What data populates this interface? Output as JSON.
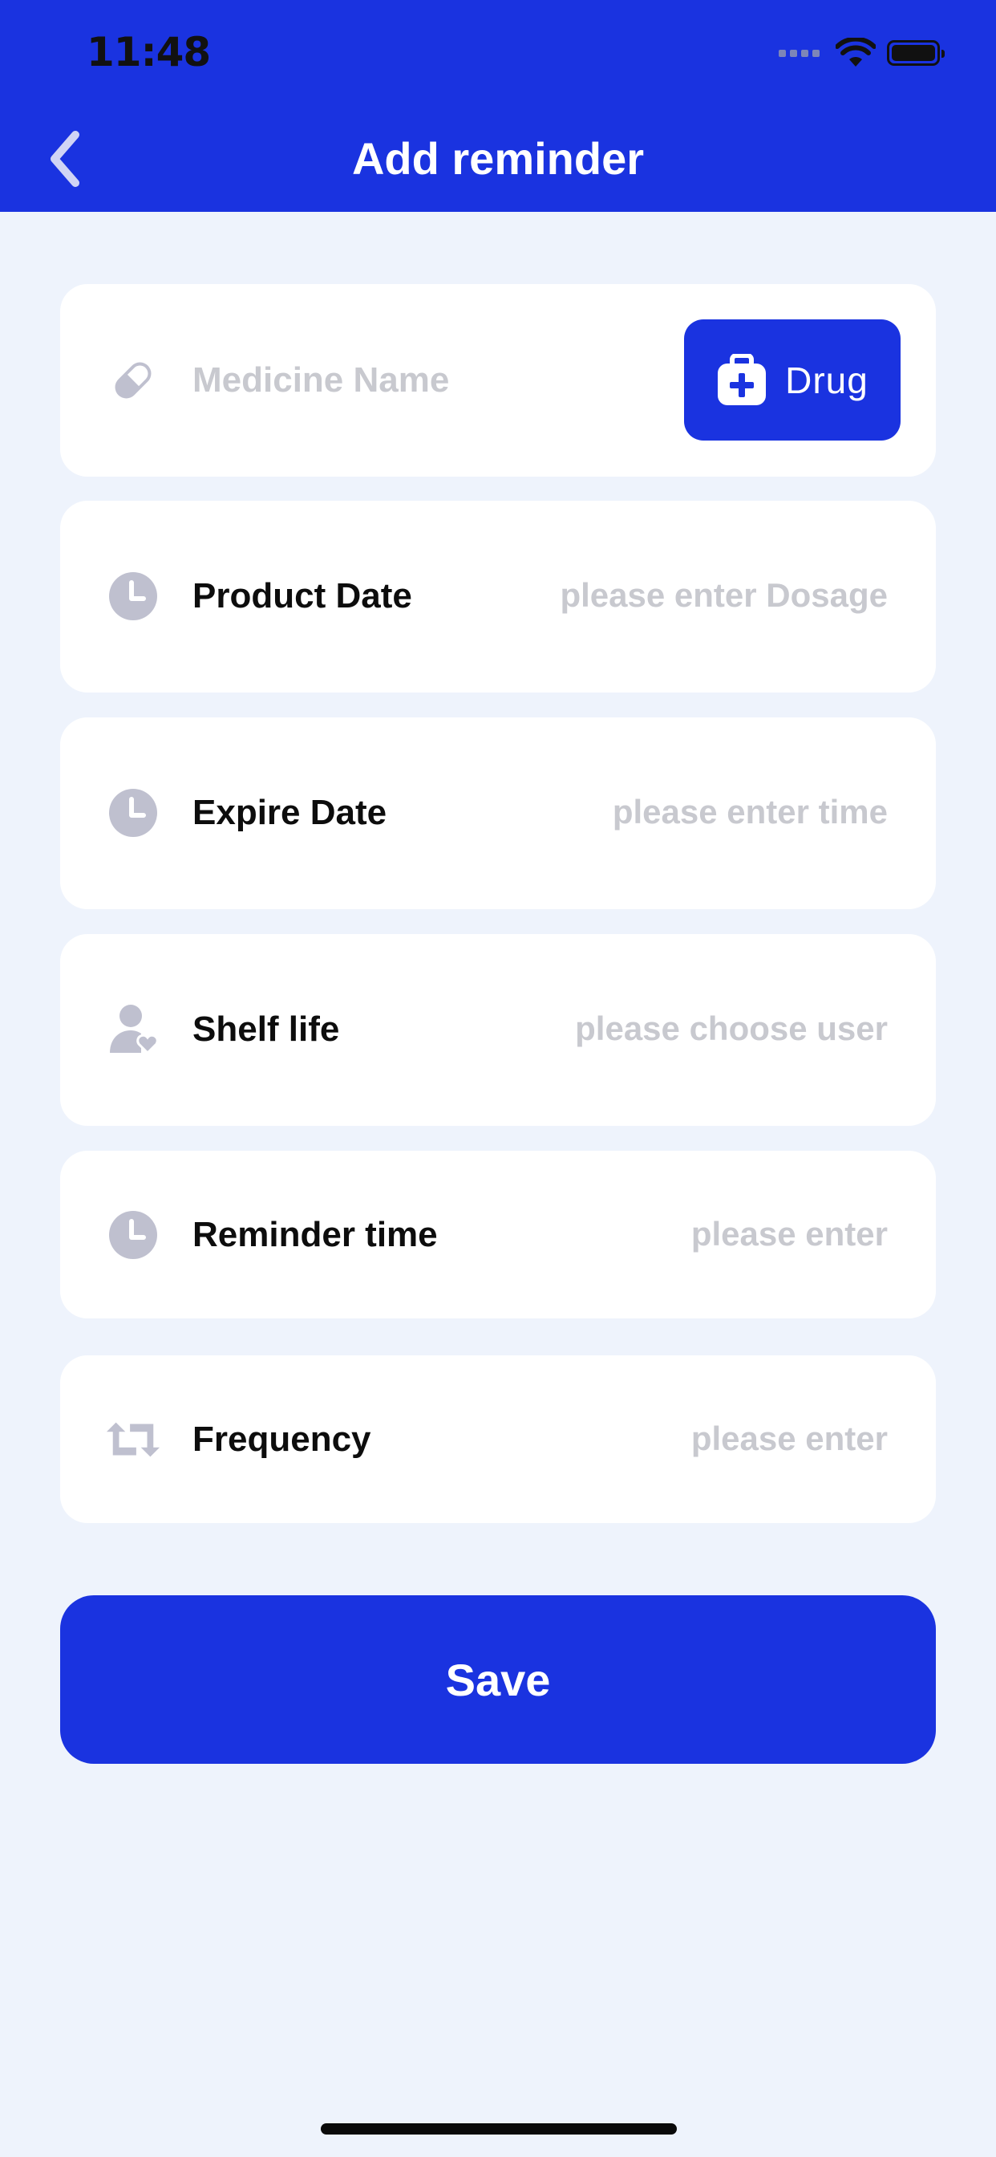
{
  "status_bar": {
    "time": "11:48"
  },
  "header": {
    "title": "Add reminder",
    "back_icon": "chevron-left-icon"
  },
  "form": {
    "medicine": {
      "placeholder": "Medicine Name",
      "icon": "pill-icon"
    },
    "drug_button": {
      "label": "Drug",
      "icon": "medkit-icon"
    },
    "rows": [
      {
        "label": "Product Date",
        "placeholder": "please enter Dosage",
        "icon": "clock-icon"
      },
      {
        "label": "Expire Date",
        "placeholder": "please enter time",
        "icon": "clock-icon"
      },
      {
        "label": "Shelf life",
        "placeholder": "please choose user",
        "icon": "user-heart-icon"
      },
      {
        "label": "Reminder time",
        "placeholder": "please enter",
        "icon": "clock-icon"
      },
      {
        "label": "Frequency",
        "placeholder": "please enter",
        "icon": "repeat-icon"
      }
    ]
  },
  "save_button": {
    "label": "Save"
  },
  "colors": {
    "primary": "#1A33E0",
    "background": "#EEF3FC",
    "icon_gray": "#BFC0CF",
    "placeholder": "#C8C9CF"
  }
}
